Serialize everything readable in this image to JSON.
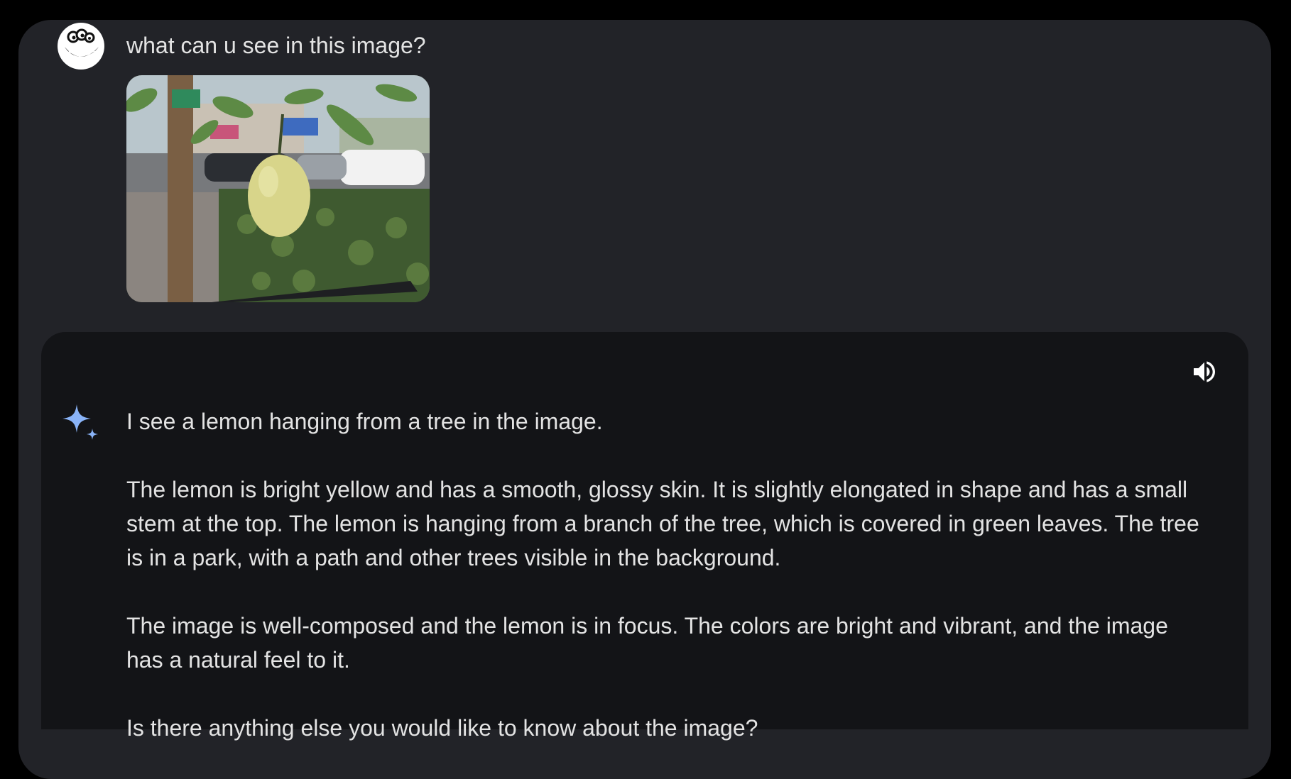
{
  "user_message": {
    "avatar_icon": "cartoon-face-icon",
    "prompt": "what can u see in this image?",
    "attachment": {
      "kind": "photo",
      "subject": "lemon-tree-photo"
    }
  },
  "assistant_message": {
    "icon": "sparkle-icon",
    "speaker_icon": "speaker-icon",
    "paragraphs": [
      "I see a lemon hanging from a tree in the image.",
      "The lemon is bright yellow and has a smooth, glossy skin. It is slightly elongated in shape and has a small stem at the top. The lemon is hanging from a branch of the tree, which is covered in green leaves. The tree is in a park, with a path and other trees visible in the background.",
      "The image is well-composed and the lemon is in focus. The colors are bright and vibrant, and the image has a natural feel to it.",
      "Is there anything else you would like to know about the image?"
    ]
  },
  "colors": {
    "page_background": "#000000",
    "chat_panel": "#222328",
    "response_card": "#131417",
    "text": "#e3e3e3",
    "sparkle_accent": "#8ab4f8"
  }
}
